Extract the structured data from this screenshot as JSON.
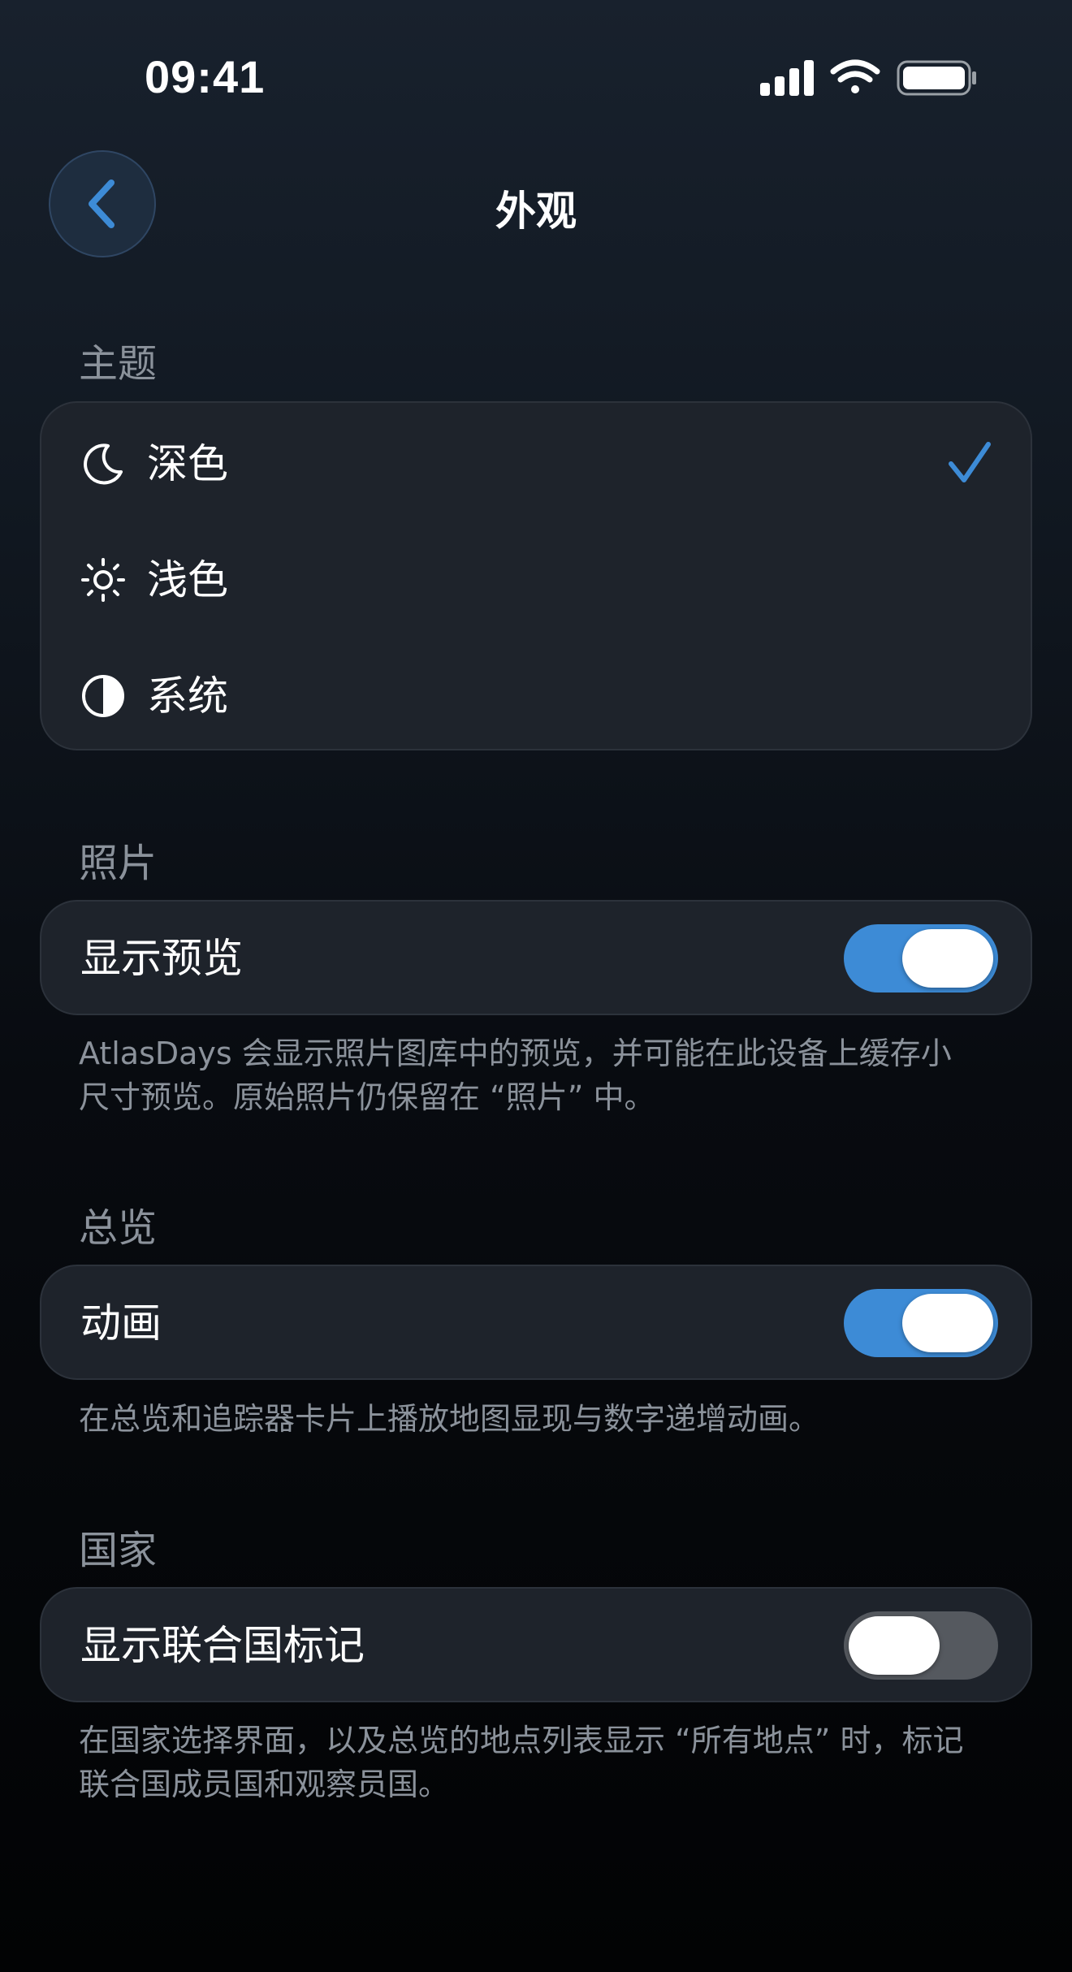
{
  "status_bar": {
    "time": "09:41",
    "icons": [
      "signal-icon",
      "wifi-icon",
      "battery-icon"
    ]
  },
  "nav": {
    "back_icon": "chevron-left-icon",
    "title": "外观"
  },
  "theme": {
    "header": "主题",
    "options": [
      {
        "icon": "moon-icon",
        "label": "深色",
        "selected": true
      },
      {
        "icon": "sun-icon",
        "label": "浅色",
        "selected": false
      },
      {
        "icon": "contrast-icon",
        "label": "系统",
        "selected": false
      }
    ]
  },
  "photos": {
    "header": "照片",
    "toggle_label": "显示预览",
    "toggle_on": true,
    "footnote": "AtlasDays 会显示照片图库中的预览，并可能在此设备上缓存小尺寸预览。原始照片仍保留在 “照片” 中。"
  },
  "overview": {
    "header": "总览",
    "toggle_label": "动画",
    "toggle_on": true,
    "footnote": "在总览和追踪器卡片上播放地图显现与数字递增动画。"
  },
  "countries": {
    "header": "国家",
    "toggle_label": "显示联合国标记",
    "toggle_on": false,
    "footnote": "在国家选择界面，以及总览的地点列表显示 “所有地点” 时，标记联合国成员国和观察员国。"
  },
  "colors": {
    "accent": "#3d8bd6",
    "card": "#1e232b",
    "secondary_text": "#8b929b",
    "toggle_off": "#55595f"
  }
}
